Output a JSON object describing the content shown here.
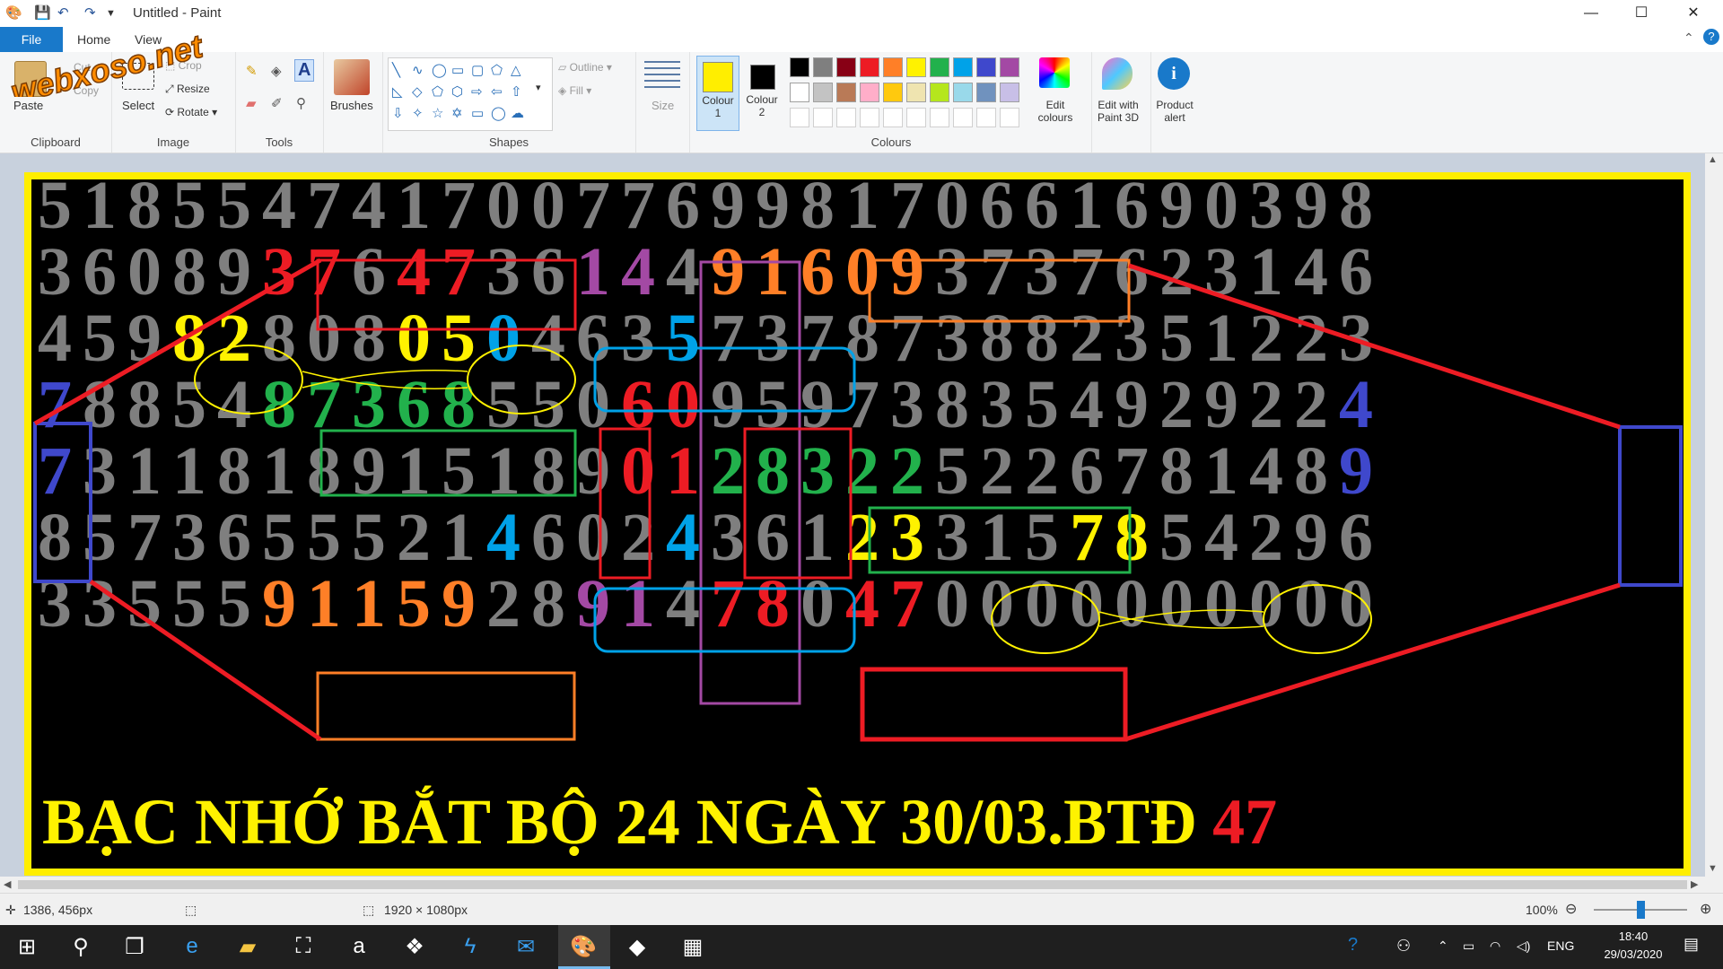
{
  "window": {
    "title": "Untitled - Paint",
    "minimize": "—",
    "maximize": "☐",
    "close": "✕",
    "help": "?",
    "collapse": "⌃"
  },
  "tabs": {
    "file": "File",
    "home": "Home",
    "view": "View"
  },
  "clipboard": {
    "paste": "Paste",
    "cut": "Cut",
    "copy": "Copy",
    "label": "Clipboard"
  },
  "image": {
    "select": "Select",
    "crop": "Crop",
    "resize": "Resize",
    "rotate": "Rotate",
    "label": "Image"
  },
  "tools": {
    "label": "Tools"
  },
  "brushes": {
    "label": "Brushes"
  },
  "shapes": {
    "outline": "Outline",
    "fill": "Fill",
    "label": "Shapes"
  },
  "size": {
    "label": "Size"
  },
  "colours": {
    "colour1": "Colour 1",
    "colour2": "Colour 2",
    "edit": "Edit colours",
    "label": "Colours",
    "colour1_value": "#ffee00",
    "colour2_value": "#000000",
    "palette_row1": [
      "#000000",
      "#7f7f7f",
      "#880015",
      "#ed1c24",
      "#ff7f27",
      "#fff200",
      "#22b14c",
      "#00a2e8",
      "#3f48cc",
      "#a349a4"
    ],
    "palette_row2": [
      "#ffffff",
      "#c3c3c3",
      "#b97a57",
      "#ffaec9",
      "#ffc90e",
      "#efe4b0",
      "#b5e61d",
      "#99d9ea",
      "#7092be",
      "#c8bfe7"
    ]
  },
  "paint3d": {
    "label": "Edit with Paint 3D"
  },
  "product_alert": {
    "label": "Product alert"
  },
  "watermark": "webxoso.net",
  "grid": {
    "rows": [
      [
        "51855",
        "47417",
        "00776",
        "99817",
        "06616",
        "90398"
      ],
      [
        "36089",
        "37647",
        "36144",
        "91609",
        "37376",
        "23146"
      ],
      [
        "45982",
        "80805",
        "04635",
        "73787",
        "38823",
        "51223"
      ],
      [
        "78854",
        "87368",
        "55060",
        "95973",
        "83549",
        "29224"
      ],
      [
        "73118",
        "18915",
        "18901",
        "28322",
        "52267",
        "81489"
      ],
      [
        "85736",
        "55521",
        "46024",
        "36123",
        "31578",
        "54296"
      ],
      [
        "33555",
        "91159",
        "28914",
        "78047",
        "00000",
        "00000"
      ]
    ],
    "caption": "BẠC NHỚ BẮT BỘ 24 NGÀY 30/03.BTĐ",
    "caption_highlight": "47"
  },
  "status": {
    "cursor_pos": "1386, 456px",
    "image_size": "1920 × 1080px",
    "zoom": "100%"
  },
  "taskbar": {
    "lang": "ENG",
    "time": "18:40",
    "date": "29/03/2020"
  }
}
